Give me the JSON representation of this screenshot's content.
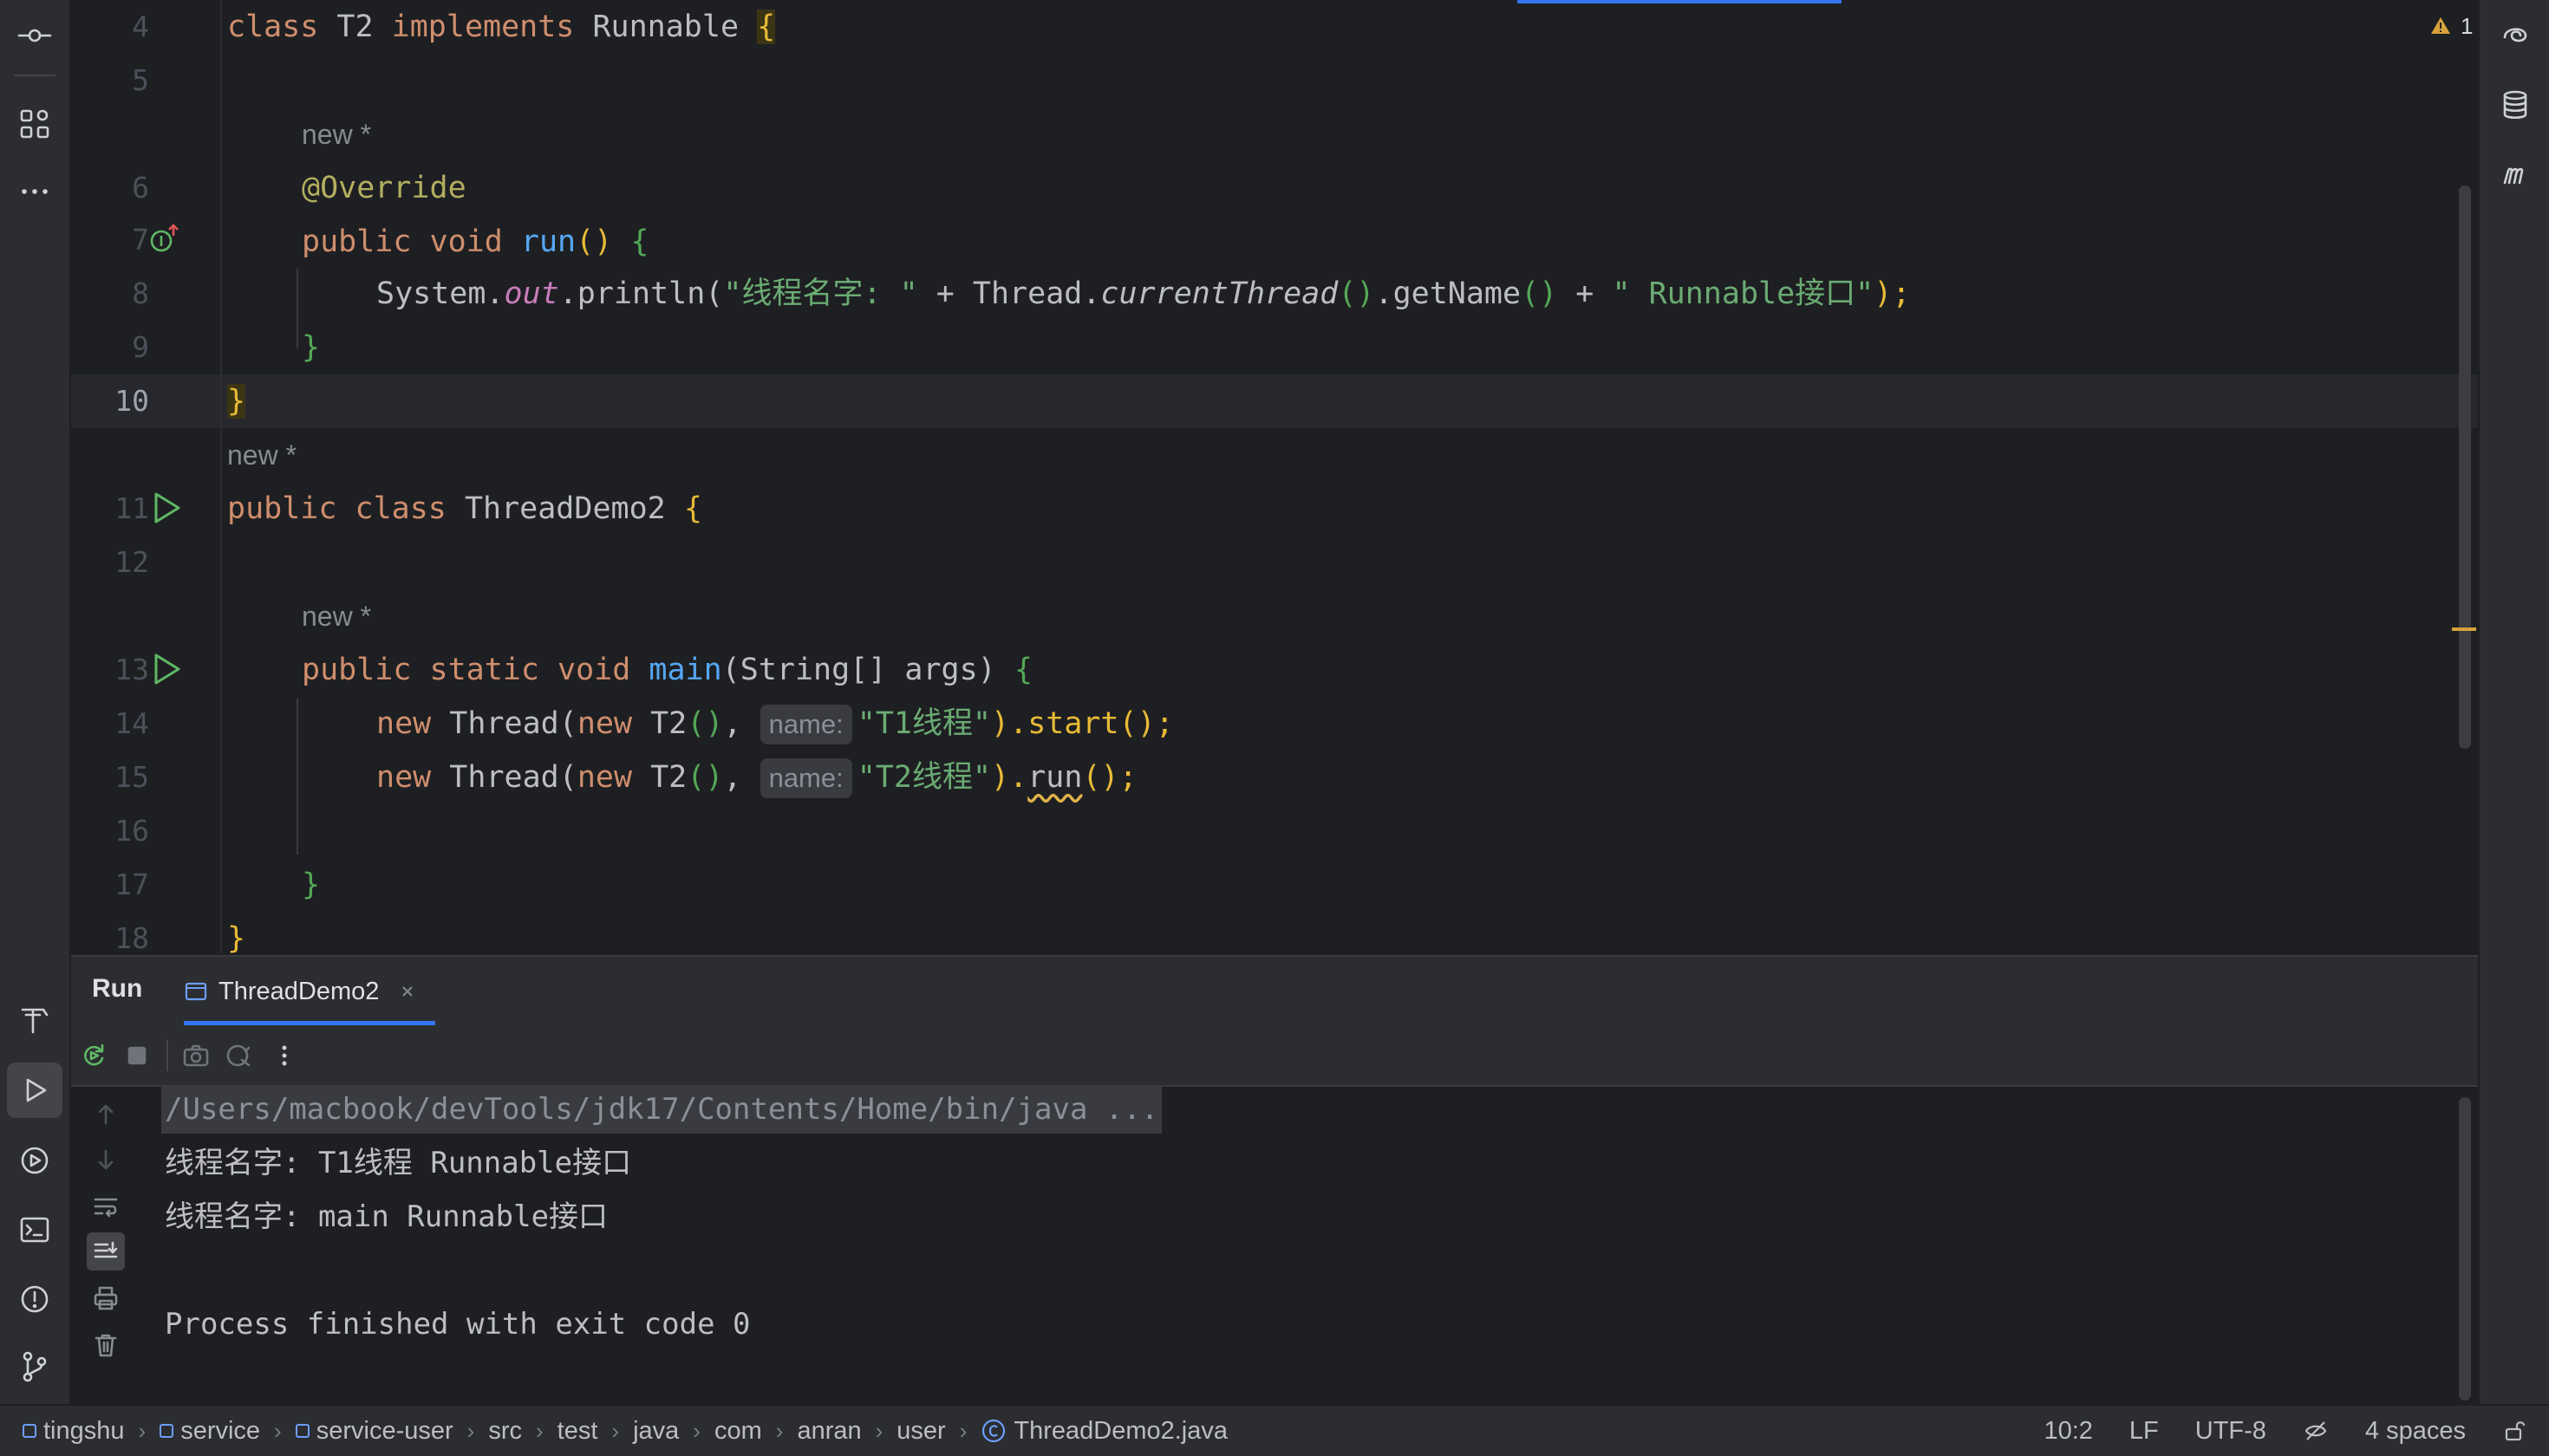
{
  "editor": {
    "warning_count": "1",
    "hint_new": "new *",
    "param_hint": "name:",
    "line_numbers": [
      "4",
      "5",
      "6",
      "7",
      "8",
      "9",
      "10",
      "11",
      "12",
      "13",
      "14",
      "15",
      "16",
      "17",
      "18"
    ],
    "code": {
      "l4": {
        "kw": "class",
        "name": " T2 ",
        "kw2": "implements",
        "type": " Runnable ",
        "br": "{"
      },
      "l6": {
        "ann": "@Override"
      },
      "l7": {
        "kw": "public void ",
        "fn": "run",
        "paren": "()",
        "br": " {"
      },
      "l8": {
        "a": "System.",
        "fld": "out",
        "b": ".println(",
        "s1": "\"线程名字: \"",
        "c": " + Thread.",
        "itl": "currentThread",
        "d": "()",
        "e": ".getName",
        "f": "()",
        "g": " + ",
        "s2": "\" Runnable接口\"",
        "h": ");"
      },
      "l9": {
        "br": "}"
      },
      "l10": {
        "br": "}"
      },
      "l11": {
        "kw": "public class ",
        "name": "ThreadDemo2 ",
        "br": "{"
      },
      "l13": {
        "kw": "public static void ",
        "fn": "main",
        "args": "(String[] args) ",
        "br": "{"
      },
      "l14": {
        "kw": "new ",
        "a": "Thread(",
        "kw2": "new ",
        "b": "T2",
        "c": "()",
        "d": ", ",
        "s": "\"T1线程\"",
        "e": ").start();"
      },
      "l15": {
        "kw": "new ",
        "a": "Thread(",
        "kw2": "new ",
        "b": "T2",
        "c": "()",
        "d": ", ",
        "s": "\"T2线程\"",
        "e": ").",
        "run": "run",
        "f": "();"
      },
      "l17": {
        "br": "}"
      },
      "l18": {
        "br": "}"
      }
    }
  },
  "run_panel": {
    "label": "Run",
    "tab": "ThreadDemo2",
    "console": [
      "/Users/macbook/devTools/jdk17/Contents/Home/bin/java ...",
      "线程名字: T1线程 Runnable接口",
      "线程名字: main Runnable接口",
      "",
      "Process finished with exit code 0"
    ]
  },
  "status_bar": {
    "breadcrumbs": [
      "tingshu",
      "service",
      "service-user",
      "src",
      "test",
      "java",
      "com",
      "anran",
      "user",
      "ThreadDemo2.java"
    ],
    "position": "10:2",
    "line_sep": "LF",
    "encoding": "UTF-8",
    "indent": "4 spaces"
  }
}
